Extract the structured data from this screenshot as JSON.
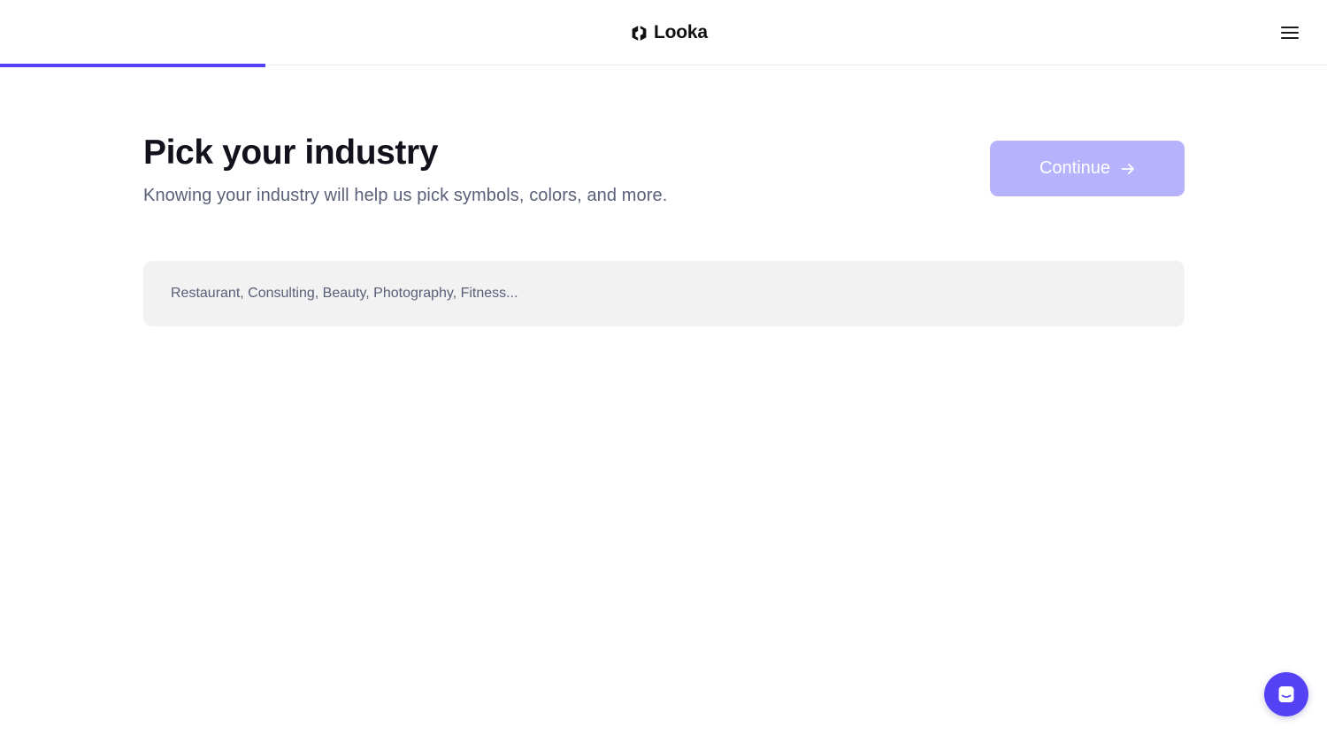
{
  "header": {
    "brand_name": "Looka",
    "logo_icon": "looka-logo-icon",
    "menu_icon": "hamburger-menu-icon"
  },
  "progress": {
    "fraction": 0.2
  },
  "main": {
    "title": "Pick your industry",
    "subtitle": "Knowing your industry will help us pick symbols, colors, and more.",
    "continue_label": "Continue",
    "continue_icon": "arrow-right-icon",
    "industry_input": {
      "value": "",
      "placeholder": "Restaurant, Consulting, Beauty, Photography, Fitness..."
    }
  },
  "chat": {
    "icon": "chat-bubble-icon"
  },
  "colors": {
    "accent": "#5542f6",
    "button_disabled": "#b6b2fb",
    "input_background": "#f2f2f3",
    "title_text": "#12121c",
    "subtitle_text": "#5a6078"
  }
}
